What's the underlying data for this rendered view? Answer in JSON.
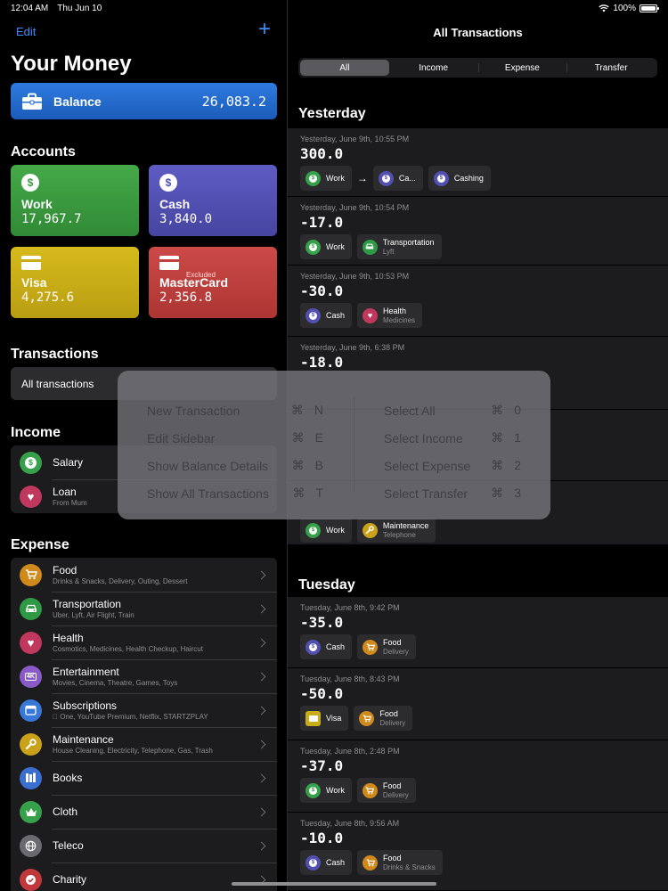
{
  "status": {
    "time": "12:04 AM",
    "date": "Thu Jun 10",
    "battery": "100%"
  },
  "sidebar": {
    "edit_label": "Edit",
    "add_label": "+",
    "title": "Your Money",
    "balance": {
      "label": "Balance",
      "value": "26,083.2"
    },
    "accounts_header": "Accounts",
    "accounts": [
      {
        "name": "Work",
        "value": "17,967.7",
        "color": "#3a9a3e"
      },
      {
        "name": "Cash",
        "value": "3,840.0",
        "color": "#5150b0"
      },
      {
        "name": "Visa",
        "value": "4,275.6",
        "color": "#c9ad17"
      },
      {
        "name": "MasterCard",
        "value": "2,356.8",
        "color": "#c2403e",
        "badge": "Excluded"
      }
    ],
    "transactions_header": "Transactions",
    "all_transactions": "All transactions",
    "income_header": "Income",
    "income": [
      {
        "title": "Salary",
        "sub": ""
      },
      {
        "title": "Loan",
        "sub": "From Mum"
      }
    ],
    "expense_header": "Expense",
    "expense": [
      {
        "title": "Food",
        "sub": "Drinks & Snacks, Delivery, Outing, Dessert",
        "color": "#d08a1c"
      },
      {
        "title": "Transportation",
        "sub": "Uber, Lyft, Air Flight, Train",
        "color": "#2f9a45"
      },
      {
        "title": "Health",
        "sub": "Cosmotics, Medicines, Health Checkup, Haircut",
        "color": "#c0385e"
      },
      {
        "title": "Entertainment",
        "sub": "Movies, Cinema, Theatre, Games, Toys",
        "color": "#8a5bc8"
      },
      {
        "title": "Subscriptions",
        "sub": " One, YouTube Premium, Netflix, STARTZPLAY",
        "color": "#3778d8"
      },
      {
        "title": "Maintenance",
        "sub": "House Cleaning, Electricity, Telephone, Gas, Trash",
        "color": "#c9a21a"
      },
      {
        "title": "Books",
        "sub": "",
        "color": "#3a6fd0"
      },
      {
        "title": "Cloth",
        "sub": "",
        "color": "#36a04a"
      },
      {
        "title": "Teleco",
        "sub": "",
        "color": "#6a6a70"
      },
      {
        "title": "Charity",
        "sub": "",
        "color": "#c0383a"
      }
    ]
  },
  "main": {
    "title": "All Transactions",
    "segments": [
      "All",
      "Income",
      "Expense",
      "Transfer"
    ],
    "days": [
      {
        "label": "Yesterday",
        "transactions": [
          {
            "date": "Yesterday, June 9th, 10:55 PM",
            "amount": "300.0"
          },
          {
            "date": "Yesterday, June 9th, 10:54 PM",
            "amount": "-17.0"
          },
          {
            "date": "Yesterday, June 9th, 10:53 PM",
            "amount": "-30.0"
          },
          {
            "date": "Yesterday, June 9th, 6:38 PM",
            "amount": "-18.0"
          }
        ]
      },
      {
        "label": "Tuesday",
        "transactions": [
          {
            "date": "Tuesday, June 8th, 9:42 PM",
            "amount": "-35.0"
          },
          {
            "date": "Tuesday, June 8th, 8:43 PM",
            "amount": "-50.0"
          },
          {
            "date": "Tuesday, June 8th, 2:48 PM",
            "amount": "-37.0"
          },
          {
            "date": "Tuesday, June 8th, 9:56 AM",
            "amount": "-10.0"
          }
        ]
      }
    ],
    "chips": {
      "work": "Work",
      "cash_short": "Ca...",
      "cashing": "Cashing",
      "cash": "Cash",
      "visa": "Visa",
      "transportation": "Transportation",
      "lyft": "Lyft",
      "health": "Health",
      "medicines": "Medicines",
      "maintenance": "Maintenance",
      "telephone": "Telephone",
      "food": "Food",
      "delivery": "Delivery",
      "drinks_snacks": "Drinks & Snacks"
    }
  },
  "shortcuts": {
    "left": [
      {
        "label": "New Transaction",
        "key": "N"
      },
      {
        "label": "Edit Sidebar",
        "key": "E"
      },
      {
        "label": "Show Balance Details",
        "key": "B"
      },
      {
        "label": "Show All Transactions",
        "key": "T"
      }
    ],
    "right": [
      {
        "label": "Select All",
        "key": "0"
      },
      {
        "label": "Select Income",
        "key": "1"
      },
      {
        "label": "Select Expense",
        "key": "2"
      },
      {
        "label": "Select Transfer",
        "key": "3"
      }
    ],
    "modifier": "⌘"
  }
}
